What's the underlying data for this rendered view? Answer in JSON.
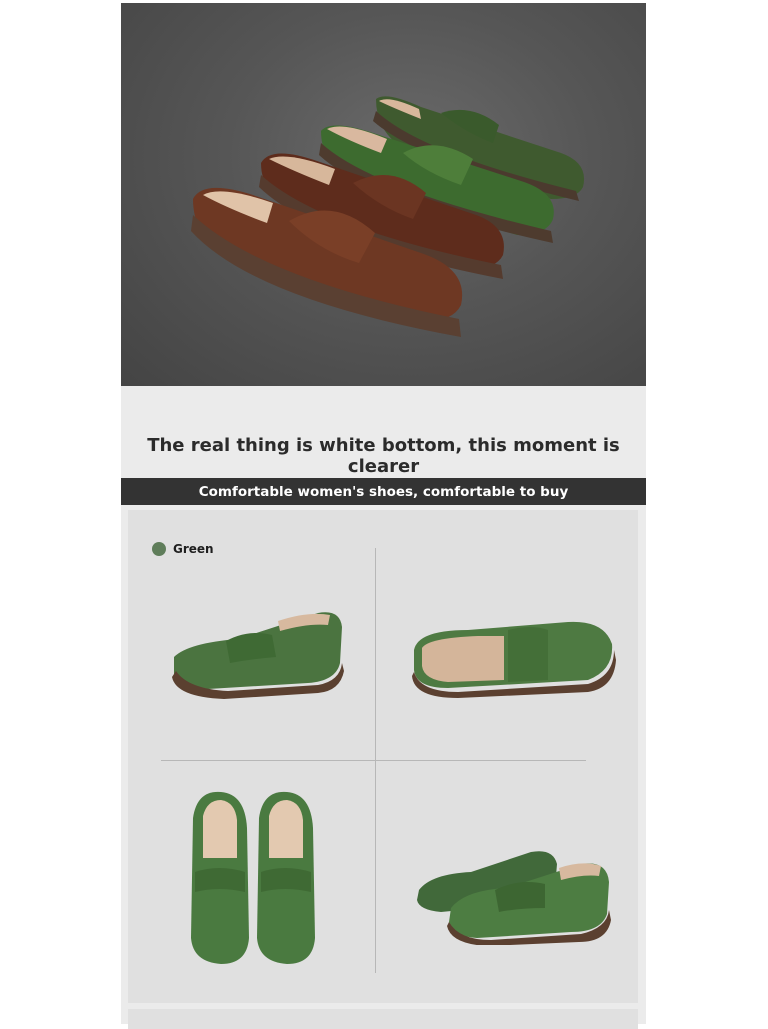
{
  "hero": {
    "image": "four penny loafers, brown and green, on grey backdrop"
  },
  "headline": "The real thing is white bottom, this moment is clearer",
  "banner": "Comfortable women's shoes, comfortable to buy",
  "color_option": {
    "label": "Green",
    "swatch": "#5f7d5a"
  },
  "colors": {
    "green_leather": "#4f6f3e",
    "brown_leather": "#6e3a24",
    "sole": "#5a4032",
    "panel": "#e0e0e0"
  }
}
